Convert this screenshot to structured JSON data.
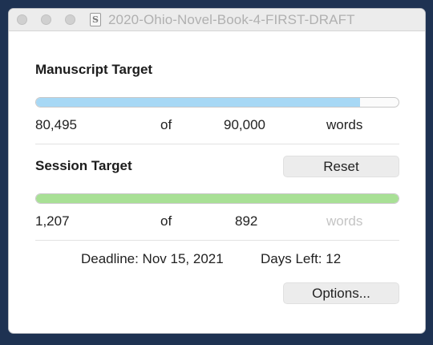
{
  "window": {
    "title": "2020-Ohio-Novel-Book-4-FIRST-DRAFT",
    "doc_icon": "S"
  },
  "manuscript": {
    "heading": "Manuscript Target",
    "current": "80,495",
    "of_label": "of",
    "target": "90,000",
    "unit": "words",
    "progress_fraction": 0.894,
    "bar_color": "#a7d8f5"
  },
  "session": {
    "heading": "Session Target",
    "reset_label": "Reset",
    "current": "1,207",
    "of_label": "of",
    "target": "892",
    "unit": "words",
    "progress_fraction": 1.0,
    "bar_color": "#a8e095"
  },
  "footer": {
    "deadline": "Deadline: Nov 15, 2021",
    "days_left": "Days Left: 12",
    "options_label": "Options..."
  }
}
